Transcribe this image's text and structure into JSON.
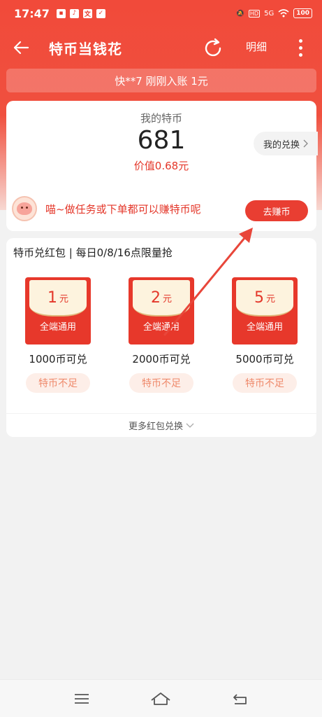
{
  "status_bar": {
    "time": "17:47",
    "network": "5G",
    "battery": "100"
  },
  "nav": {
    "title": "特币当钱花",
    "detail_label": "明细"
  },
  "ticker": {
    "text": "快**7 刚刚入账 1元"
  },
  "coins": {
    "label": "我的特币",
    "amount": "681",
    "value_text": "价值0.68元",
    "exchange_label": "我的兑换",
    "tip_text": "喵~做任务或下单都可以赚特币呢",
    "earn_label": "去赚币"
  },
  "redpacks": {
    "header": "特币兑红包 | 每日0/8/16点限量抢",
    "items": [
      {
        "amount": "1",
        "unit": "元",
        "scope": "全端通用",
        "price": "1000币可兑",
        "status": "特币不足"
      },
      {
        "amount": "2",
        "unit": "元",
        "scope": "全端通用",
        "price": "2000币可兑",
        "status": "特币不足"
      },
      {
        "amount": "5",
        "unit": "元",
        "scope": "全端通用",
        "price": "5000币可兑",
        "status": "特币不足"
      }
    ],
    "more_label": "更多红包兑换"
  },
  "colors": {
    "brand_red": "#e93e32",
    "accent_text": "#e4372a"
  },
  "icons": [
    "back-arrow-icon",
    "refresh-icon",
    "more-vertical-icon",
    "chevron-right-icon",
    "chevron-down-icon",
    "menu-icon",
    "home-icon",
    "back-icon"
  ]
}
